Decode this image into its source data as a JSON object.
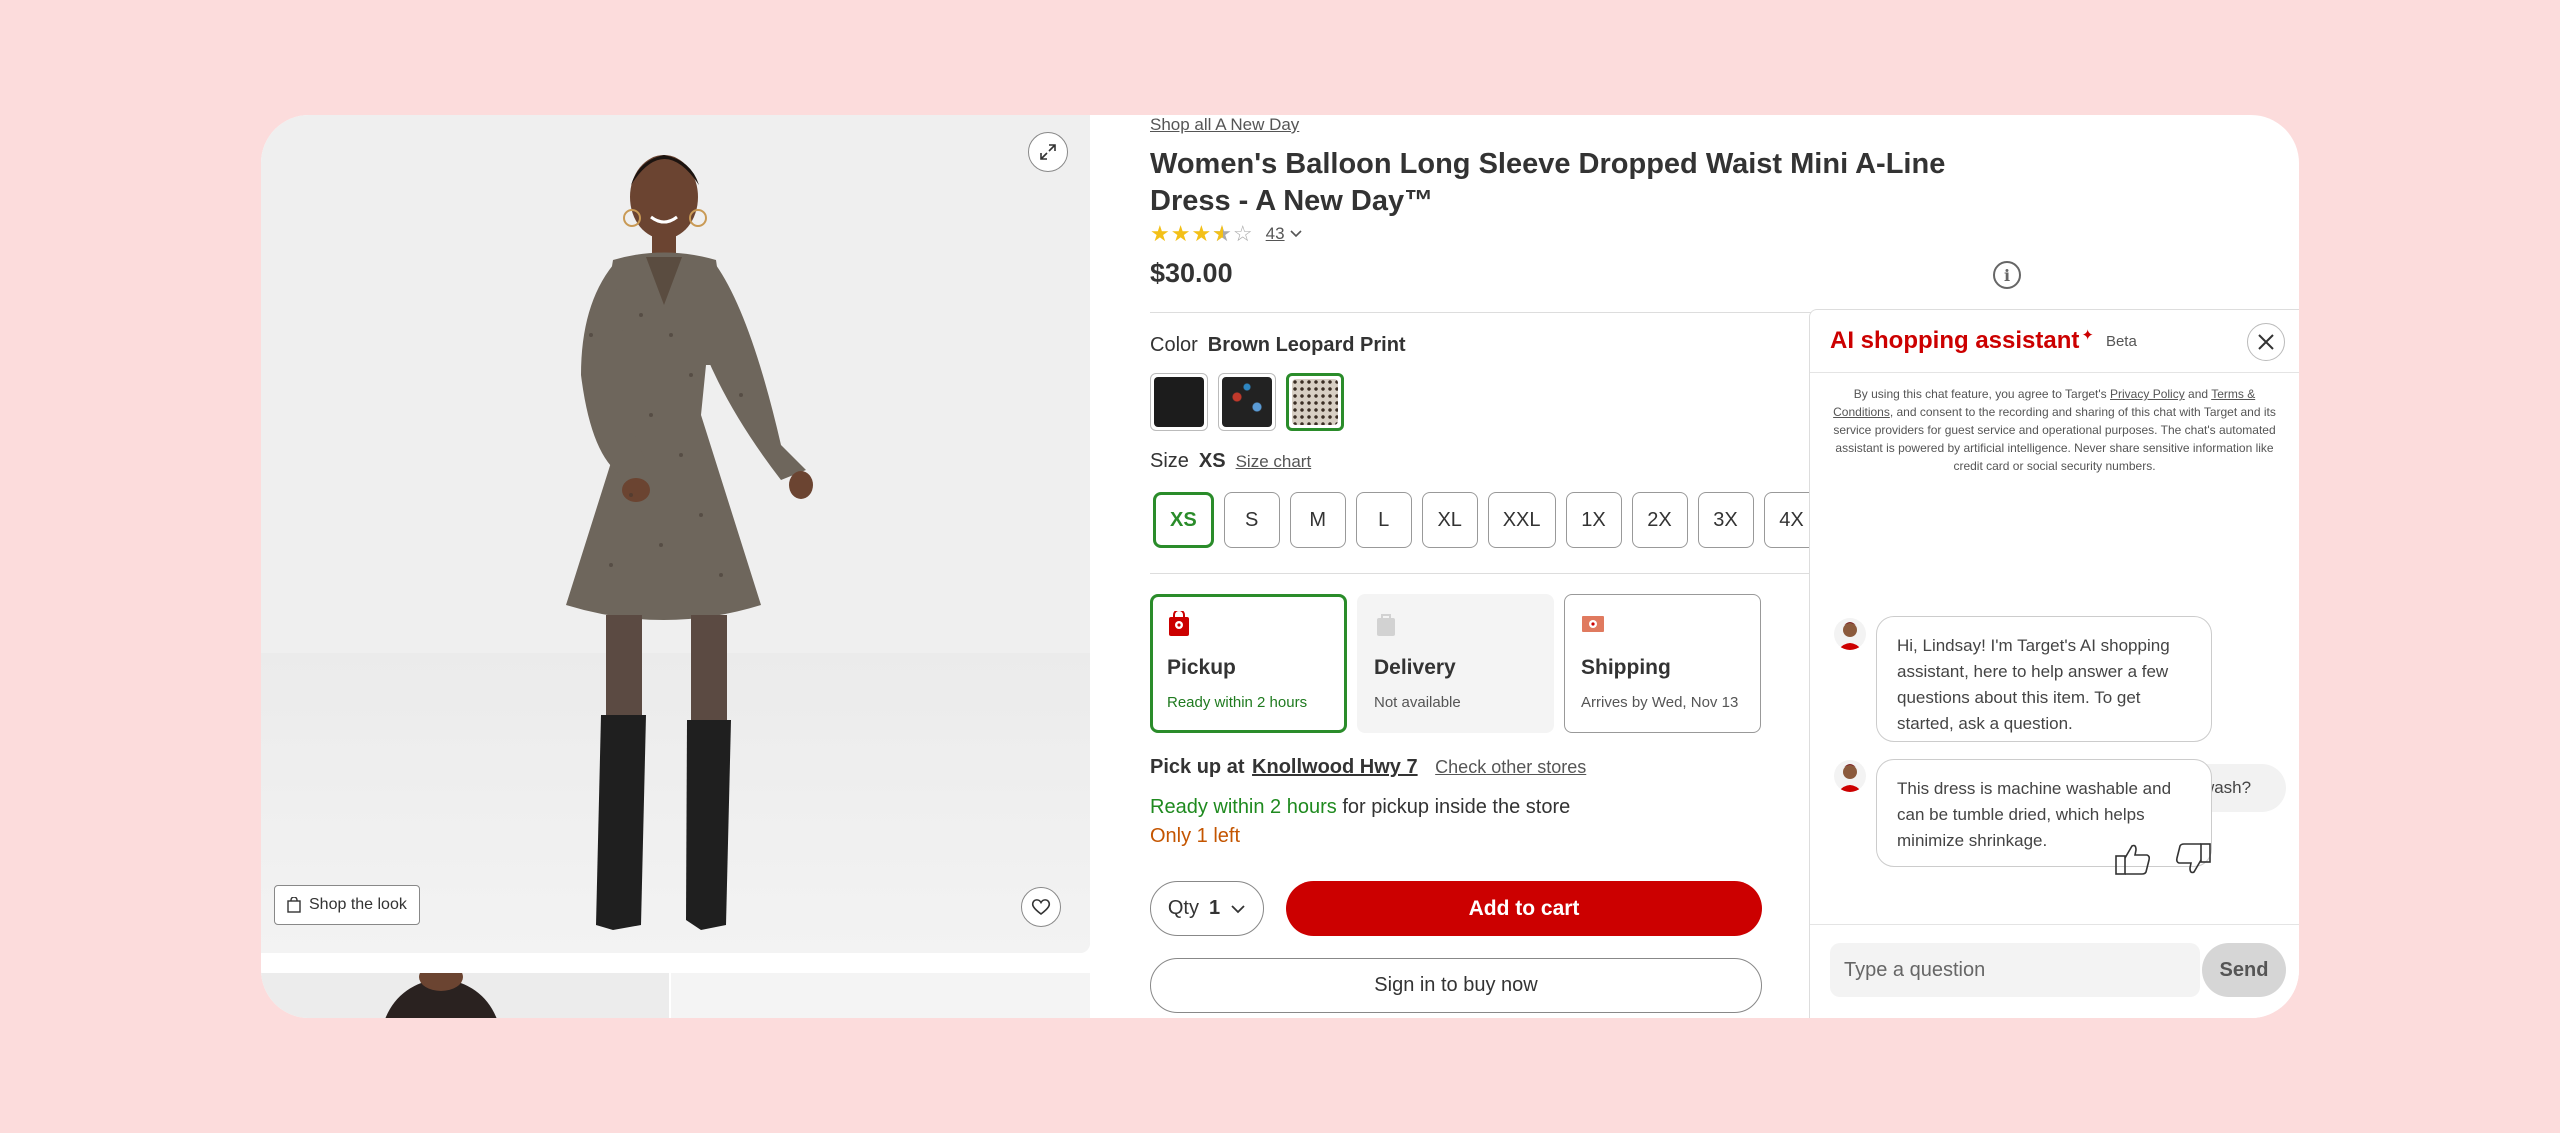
{
  "gallery": {
    "shop_look_label": "Shop the look"
  },
  "product": {
    "breadcrumb": "Shop all A New Day",
    "title": "Women's Balloon Long Sleeve Dropped Waist Mini A-Line Dress - A New Day™",
    "rating": 3.5,
    "rating_count": "43",
    "price": "$30.00",
    "color_label": "Color",
    "color_value": "Brown Leopard Print",
    "swatches": [
      "black",
      "floral",
      "brown-leopard-print"
    ],
    "size_label": "Size",
    "size_value": "XS",
    "size_chart_label": "Size chart",
    "sizes": [
      "XS",
      "S",
      "M",
      "L",
      "XL",
      "XXL",
      "1X",
      "2X",
      "3X",
      "4X"
    ],
    "selected_size": "XS"
  },
  "fulfillment": [
    {
      "title": "Pickup",
      "sub": "Ready within 2 hours",
      "icon": "store-pickup-icon"
    },
    {
      "title": "Delivery",
      "sub": "Not available",
      "icon": "bag-icon"
    },
    {
      "title": "Shipping",
      "sub": "Arrives by Wed, Nov 13",
      "icon": "box-icon"
    }
  ],
  "pickup": {
    "prefix": "Pick up at",
    "store": "Knollwood Hwy 7",
    "other_stores": "Check other stores",
    "ready_green": "Ready within 2 hours",
    "ready_rest": " for pickup inside the store",
    "stock": "Only 1 left"
  },
  "purchase": {
    "qty_label": "Qty",
    "qty_value": "1",
    "add_to_cart": "Add to cart",
    "sign_in": "Sign in to buy now"
  },
  "chat": {
    "title": "AI shopping assistant",
    "beta": "Beta",
    "disclaimer_1": "By using this chat feature, you agree to Target's ",
    "privacy": "Privacy Policy",
    "and": " and ",
    "terms": "Terms & Conditions",
    "disclaimer_2": ", and consent to the recording and sharing of this chat with Target and its service providers for guest service and operational purposes. The chat's automated assistant is powered by artificial intelligence. Never share sensitive information like credit card or social security numbers.",
    "messages": [
      {
        "from": "bot",
        "text": "Hi, Lindsay! I'm Target's AI shopping assistant, here to help answer a few questions about this item. To get started, ask a question."
      },
      {
        "from": "user",
        "text": "Will this dress shrink in the wash?"
      },
      {
        "from": "bot",
        "text": "This dress is machine washable and can be tumble dried, which helps minimize shrinkage."
      }
    ],
    "input_placeholder": "Type a question",
    "send_label": "Send"
  },
  "colors": {
    "brand_red": "#cc0000",
    "selected_green": "#2a8c2a",
    "background": "#fcdcdc"
  }
}
